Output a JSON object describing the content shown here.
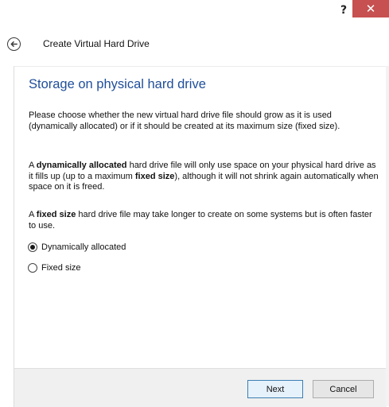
{
  "titlebar": {
    "help_label": "?",
    "close_label": "✕",
    "close_color": "#c75050"
  },
  "header": {
    "back_icon": "back-arrow-icon",
    "title": "Create Virtual Hard Drive"
  },
  "main": {
    "page_title": "Storage on physical hard drive",
    "paragraph1": "Please choose whether the new virtual hard drive file should grow as it is used (dynamically allocated) or if it should be created at its maximum size (fixed size).",
    "paragraph2": {
      "pre": "A ",
      "bold1": "dynamically allocated",
      "mid": " hard drive file will only use space on your physical hard drive as it fills up (up to a maximum ",
      "bold2": "fixed size",
      "post": "), although it will not shrink again automatically when space on it is freed."
    },
    "paragraph3": {
      "pre": "A ",
      "bold": "fixed size",
      "post": " hard drive file may take longer to create on some systems but is often faster to use."
    },
    "options": [
      {
        "label": "Dynamically allocated",
        "selected": true
      },
      {
        "label": "Fixed size",
        "selected": false
      }
    ]
  },
  "footer": {
    "next_label": "Next",
    "cancel_label": "Cancel"
  },
  "colors": {
    "title_blue": "#1f4e9a",
    "footer_bg": "#f0f0f0"
  }
}
